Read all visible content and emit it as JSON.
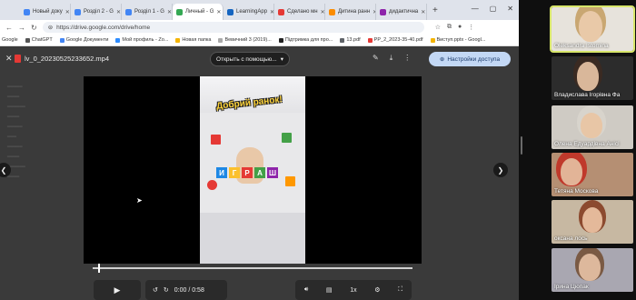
{
  "browser": {
    "tabs": [
      {
        "title": "Новый доку"
      },
      {
        "title": "Розділ 2 - G"
      },
      {
        "title": "Розділ 1 - G"
      },
      {
        "title": "Личный - G",
        "active": true
      },
      {
        "title": "LearningApp"
      },
      {
        "title": "Сделано мн"
      },
      {
        "title": "Дитина ранн"
      },
      {
        "title": "дидактична"
      }
    ],
    "url": "https://drive.google.com/drive/home",
    "bookmarks": [
      "Google",
      "ChatGPT",
      "Google Документи",
      "Мой профиль - Zo...",
      "Новая папка",
      "Вевичний 3 (2019)...",
      "Підтримка для про...",
      "13.pdf",
      "PP_2_2023-35-40.pdf",
      "Виступ.pptx - Googl..."
    ]
  },
  "viewer": {
    "file_name": "lv_0_20230525233652.mp4",
    "open_with_label": "Открыть с помощью...",
    "share_label": "Настройки доступа",
    "video_caption": "Добрий ранок!",
    "time_display": "0:00 / 0:58",
    "speed_label": "1x",
    "progress": 0.0
  },
  "participants": [
    {
      "name": "Oleksandra Istomina",
      "bg": "#e7e3dc",
      "speaking": true
    },
    {
      "name": "Владислава Ігорівна Фа",
      "bg": "#2c2c2c"
    },
    {
      "name": "Олена Едуардівна Анісі",
      "bg": "#cfcbc4"
    },
    {
      "name": "Тетяна Москова",
      "bg": "#b58f73"
    },
    {
      "name": "оксана лось",
      "bg": "#c7b8a2"
    },
    {
      "name": "Ірина Цюпак",
      "bg": "#a9a7b1"
    }
  ]
}
